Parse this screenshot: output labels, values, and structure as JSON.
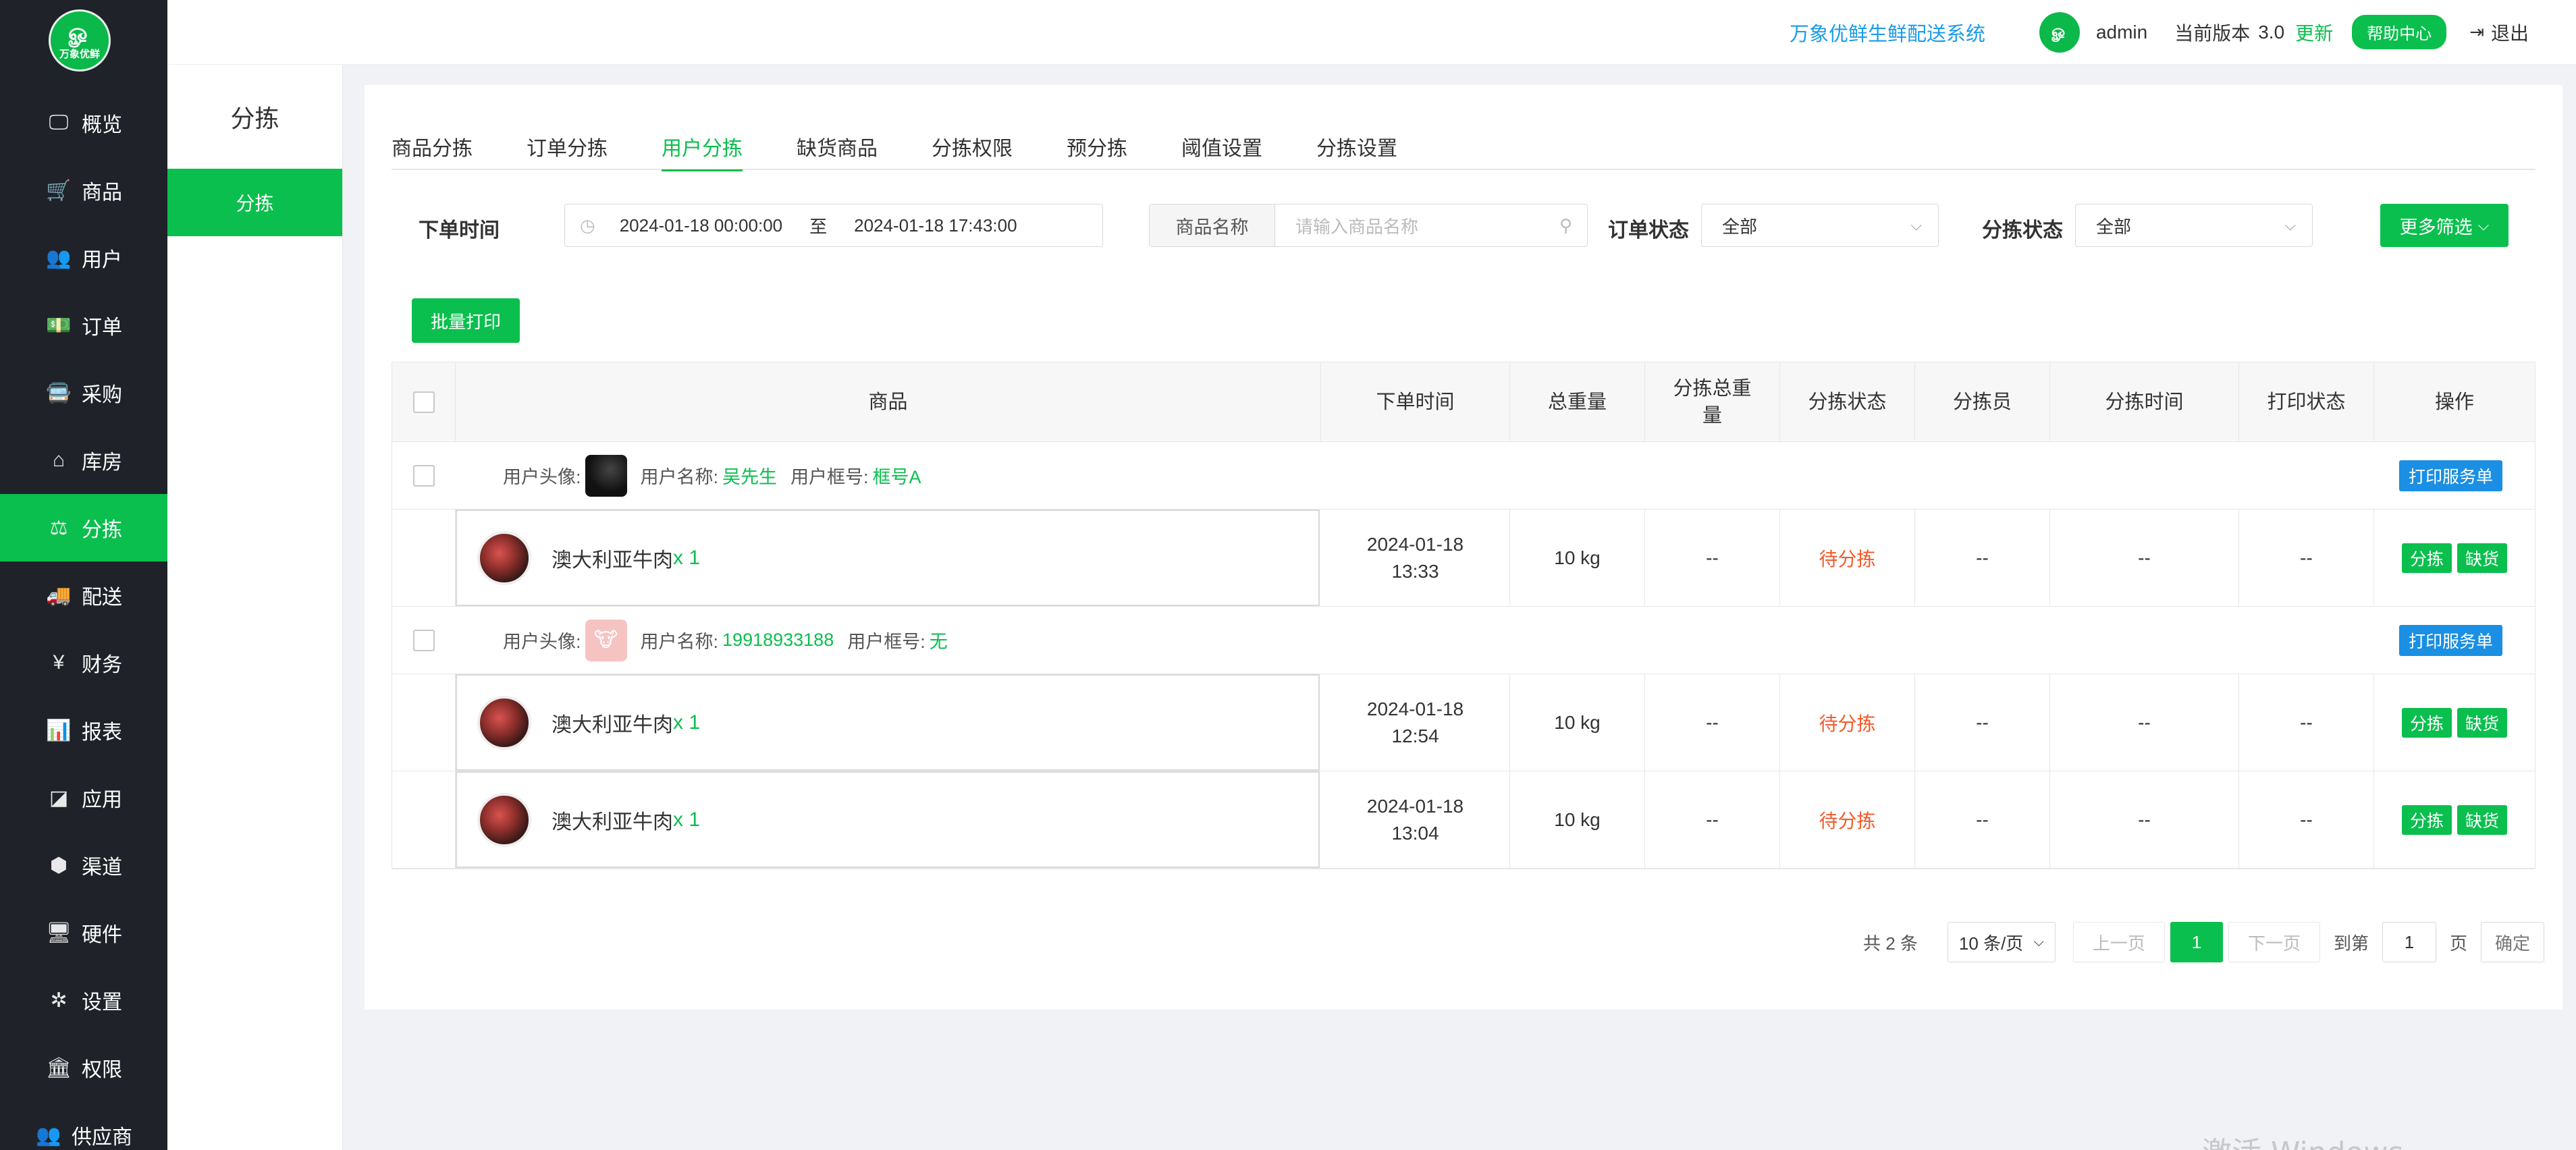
{
  "sidebar": {
    "logo_text": "万象优鲜",
    "items": [
      {
        "label": "概览",
        "icon": "monitor-icon",
        "glyph": "🖵"
      },
      {
        "label": "商品",
        "icon": "cart-icon",
        "glyph": "🛒"
      },
      {
        "label": "用户",
        "icon": "users-icon",
        "glyph": "👥"
      },
      {
        "label": "订单",
        "icon": "money-icon",
        "glyph": "💵"
      },
      {
        "label": "采购",
        "icon": "truck-icon",
        "glyph": "🚍"
      },
      {
        "label": "库房",
        "icon": "home-icon",
        "glyph": "⌂"
      },
      {
        "label": "分拣",
        "icon": "scale-icon",
        "glyph": "⚖",
        "active": true
      },
      {
        "label": "配送",
        "icon": "delivery-icon",
        "glyph": "🚚"
      },
      {
        "label": "财务",
        "icon": "yen-icon",
        "glyph": "¥"
      },
      {
        "label": "报表",
        "icon": "bar-chart-icon",
        "glyph": "📊"
      },
      {
        "label": "应用",
        "icon": "apps-icon",
        "glyph": "◪"
      },
      {
        "label": "渠道",
        "icon": "cube-icon",
        "glyph": "⬢"
      },
      {
        "label": "硬件",
        "icon": "desktop-icon",
        "glyph": "🖥"
      },
      {
        "label": "设置",
        "icon": "puzzle-icon",
        "glyph": "✲"
      },
      {
        "label": "权限",
        "icon": "bank-icon",
        "glyph": "🏛"
      },
      {
        "label": "供应商",
        "icon": "supplier-icon",
        "glyph": "👥"
      }
    ]
  },
  "subnav": {
    "title": "分拣",
    "item": "分拣"
  },
  "header": {
    "system_name": "万象优鲜生鲜配送系统",
    "user": "admin",
    "version_label": "当前版本",
    "version": "3.0",
    "update": "更新",
    "help": "帮助中心",
    "logout": "退出"
  },
  "tabs": [
    {
      "label": "商品分拣"
    },
    {
      "label": "订单分拣"
    },
    {
      "label": "用户分拣",
      "active": true
    },
    {
      "label": "缺货商品"
    },
    {
      "label": "分拣权限"
    },
    {
      "label": "预分拣"
    },
    {
      "label": "阈值设置"
    },
    {
      "label": "分拣设置"
    }
  ],
  "filters": {
    "order_time_label": "下单时间",
    "date_start": "2024-01-18 00:00:00",
    "date_sep": "至",
    "date_end": "2024-01-18 17:43:00",
    "product_name_label": "商品名称",
    "product_name_placeholder": "请输入商品名称",
    "order_status_label": "订单状态",
    "order_status_value": "全部",
    "sort_status_label": "分拣状态",
    "sort_status_value": "全部",
    "more_filters": "更多筛选"
  },
  "batch_print": "批量打印",
  "table": {
    "headers": {
      "product": "商品",
      "order_time": "下单时间",
      "total_weight": "总重量",
      "sort_total_weight": "分拣总重量",
      "sort_status": "分拣状态",
      "sorter": "分拣员",
      "sort_time": "分拣时间",
      "print_status": "打印状态",
      "actions": "操作"
    },
    "labels": {
      "avatar": "用户头像:",
      "user_name": "用户名称:",
      "frame_no": "用户框号:",
      "print_service": "打印服务单",
      "sort": "分拣",
      "out_of_stock": "缺货"
    },
    "groups": [
      {
        "user_name": "吴先生",
        "frame_no": "框号A",
        "avatar_style": "dark",
        "items": [
          {
            "name": "澳大利亚牛肉",
            "qty": "x 1",
            "date": "2024-01-18",
            "time": "13:33",
            "weight": "10 kg",
            "sort_weight": "--",
            "status": "待分拣",
            "sorter": "--",
            "sort_time": "--",
            "print": "--"
          }
        ]
      },
      {
        "user_name": "19918933188",
        "frame_no": "无",
        "avatar_style": "pink",
        "items": [
          {
            "name": "澳大利亚牛肉",
            "qty": "x 1",
            "date": "2024-01-18",
            "time": "12:54",
            "weight": "10 kg",
            "sort_weight": "--",
            "status": "待分拣",
            "sorter": "--",
            "sort_time": "--",
            "print": "--"
          },
          {
            "name": "澳大利亚牛肉",
            "qty": "x 1",
            "date": "2024-01-18",
            "time": "13:04",
            "weight": "10 kg",
            "sort_weight": "--",
            "status": "待分拣",
            "sorter": "--",
            "sort_time": "--",
            "print": "--"
          }
        ]
      }
    ]
  },
  "pagination": {
    "total": "共 2 条",
    "page_size": "10 条/页",
    "prev": "上一页",
    "current": "1",
    "next": "下一页",
    "goto": "到第",
    "goto_value": "1",
    "page_unit": "页",
    "confirm": "确定"
  },
  "watermark": "激活 Windows"
}
